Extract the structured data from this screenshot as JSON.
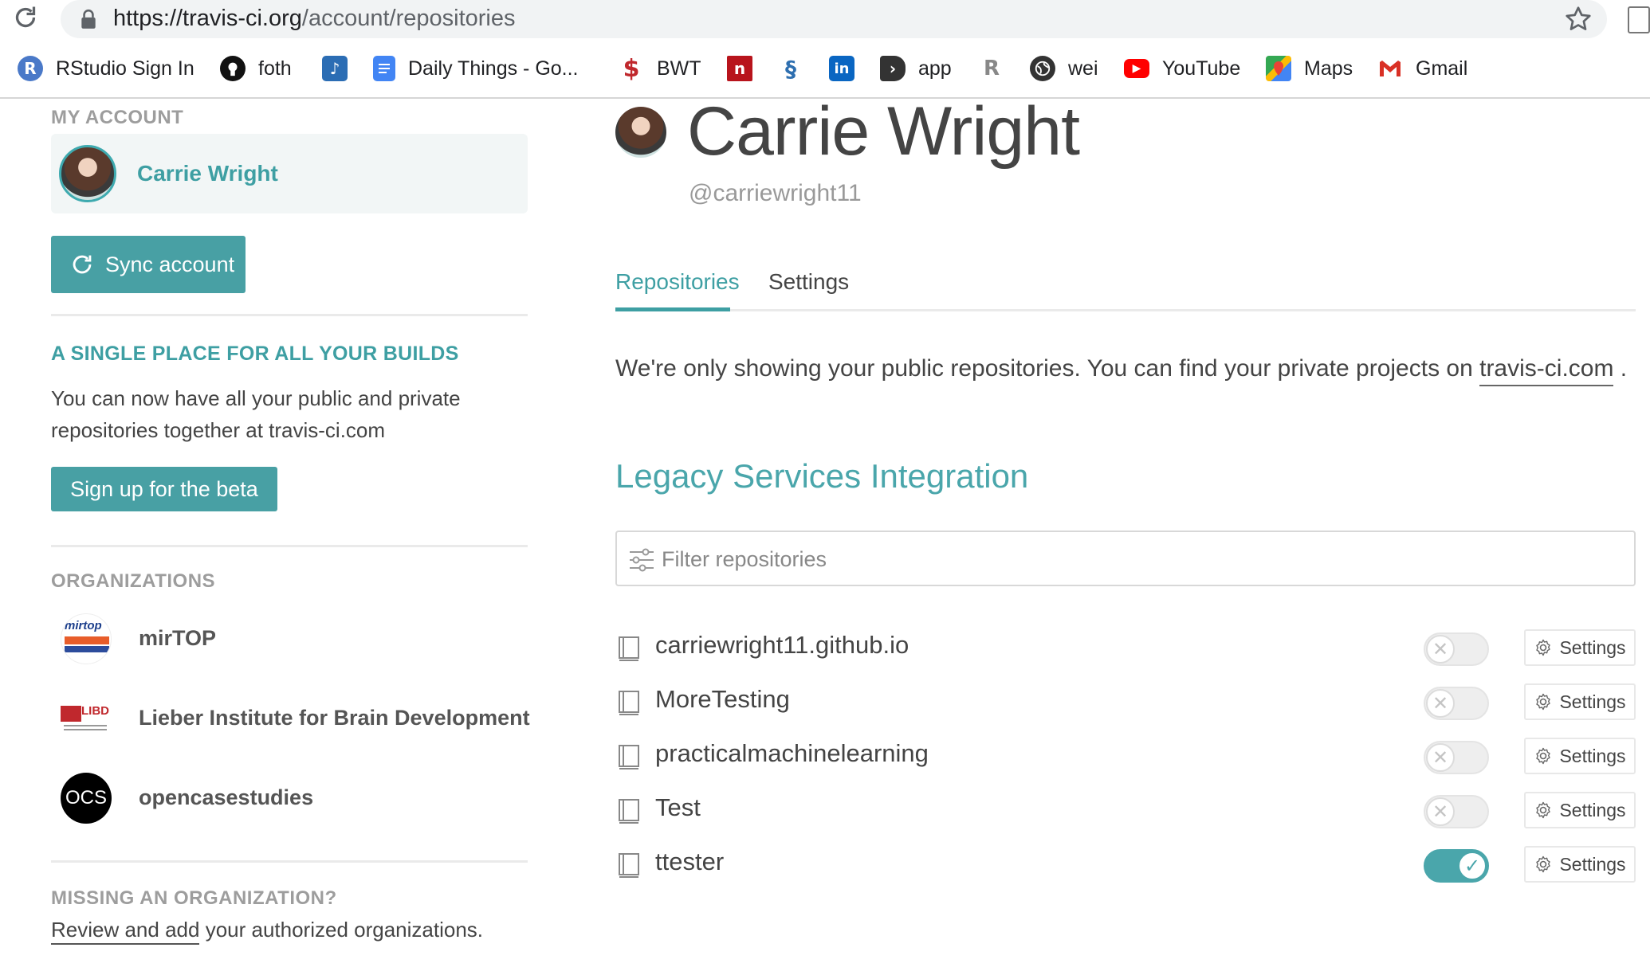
{
  "browser": {
    "url_host": "https://travis-ci.org",
    "url_path": "/account/repositories",
    "bookmarks": [
      {
        "label": "RStudio Sign In",
        "icon": "rstudio-icon",
        "color": "#4a79c8"
      },
      {
        "label": "foth",
        "icon": "github-icon",
        "color": "#000000"
      },
      {
        "label": "",
        "icon": "music-note-icon",
        "color": "#2b6db4"
      },
      {
        "label": "Daily Things - Go...",
        "icon": "google-docs-icon",
        "color": "#4285f4"
      },
      {
        "label": "BWT",
        "icon": "bwt-icon",
        "color": "#c0282d"
      },
      {
        "label": "",
        "icon": "n-icon",
        "color": "#b8141c"
      },
      {
        "label": "",
        "icon": "swirl-icon",
        "color": "#2e6fb0"
      },
      {
        "label": "",
        "icon": "linkedin-icon",
        "color": "#0a66c2"
      },
      {
        "label": "app",
        "icon": "app-icon",
        "color": "#333333"
      },
      {
        "label": "",
        "icon": "grad-cap-icon",
        "color": "#888888"
      },
      {
        "label": "wei",
        "icon": "globe-icon",
        "color": "#333333"
      },
      {
        "label": "YouTube",
        "icon": "youtube-icon",
        "color": "#ff0000"
      },
      {
        "label": "Maps",
        "icon": "maps-icon",
        "color": "#34a853"
      },
      {
        "label": "Gmail",
        "icon": "gmail-icon",
        "color": "#d93025"
      }
    ]
  },
  "sidebar": {
    "my_account_heading": "MY ACCOUNT",
    "account_name": "Carrie Wright",
    "sync_button": "Sync account",
    "promo_heading": "A SINGLE PLACE FOR ALL YOUR BUILDS",
    "promo_text": "You can now have all your public and private repositories together at travis-ci.com",
    "beta_button": "Sign up for the beta",
    "organizations_heading": "ORGANIZATIONS",
    "organizations": [
      {
        "name": "mirTOP",
        "logo_text": "mirtop"
      },
      {
        "name": "Lieber Institute for Brain Development",
        "logo_text": "LIBD"
      },
      {
        "name": "opencasestudies",
        "logo_text": "OCS"
      }
    ],
    "missing_heading": "MISSING AN ORGANIZATION?",
    "missing_link": "Review and add",
    "missing_text": " your authorized organizations."
  },
  "profile": {
    "name": "Carrie Wright",
    "handle": "@carriewright11"
  },
  "tabs": [
    {
      "label": "Repositories",
      "active": true
    },
    {
      "label": "Settings",
      "active": false
    }
  ],
  "notice": {
    "text": "We're only showing your public repositories. You can find your private projects on ",
    "link": "travis-ci.com",
    "suffix": " ."
  },
  "legacy_heading": "Legacy Services Integration",
  "filter": {
    "placeholder": "Filter repositories"
  },
  "repo_settings_label": "Settings",
  "repositories": [
    {
      "name": "carriewright11.github.io",
      "enabled": false
    },
    {
      "name": "MoreTesting",
      "enabled": false
    },
    {
      "name": "practicalmachinelearning",
      "enabled": false
    },
    {
      "name": "Test",
      "enabled": false
    },
    {
      "name": "ttester",
      "enabled": true
    }
  ],
  "colors": {
    "accent": "#3e9fa3",
    "button": "#48a0a4"
  }
}
